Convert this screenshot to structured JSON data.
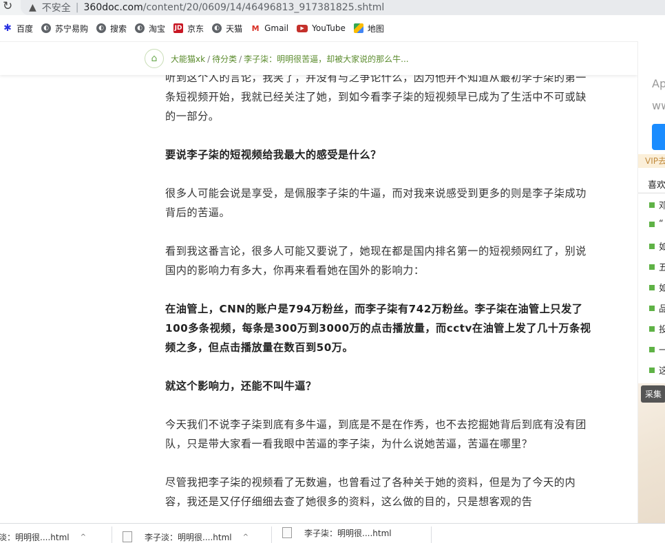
{
  "browser": {
    "reload_icon": "reload-icon",
    "security_label": "不安全",
    "url_host": "360doc.com",
    "url_path": "/content/20/0609/14/46496813_917381825.shtml"
  },
  "bookmarks": [
    {
      "label": "百度",
      "icon": "baidu-icon"
    },
    {
      "label": "苏宁易购",
      "icon": "globe-icon"
    },
    {
      "label": "搜索",
      "icon": "globe-icon"
    },
    {
      "label": "淘宝",
      "icon": "globe-icon"
    },
    {
      "label": "京东",
      "icon": "jd-icon"
    },
    {
      "label": "天猫",
      "icon": "globe-icon"
    },
    {
      "label": "Gmail",
      "icon": "gmail-icon"
    },
    {
      "label": "YouTube",
      "icon": "youtube-icon"
    },
    {
      "label": "地图",
      "icon": "maps-icon"
    }
  ],
  "breadcrumb": {
    "user": "大能猫xk",
    "category": "待分类",
    "title": "李子柒：明明很苦逼，却被大家说的那么牛..."
  },
  "article": {
    "p0": "听到这个人的言论，我笑了，并没有与之争论什么，因为他并不知道从最初李子柒的第一条短视频开始，我就已经关注了她，到如今看李子柒的短视频早已成为了生活中不可或缺的一部分。",
    "p1": "要说李子柒的短视频给我最大的感受是什么？",
    "p2": "很多人可能会说是享受，是佩服李子柒的牛逼，而对我来说感受到更多的则是李子柒成功背后的苦逼。",
    "p3": "看到我这番言论，很多人可能又要说了，她现在都是国内排名第一的短视频网红了，别说国内的影响力有多大，你再来看看她在国外的影响力：",
    "p4": "在油管上，CNN的账户是794万粉丝，而李子柒有742万粉丝。李子柒在油管上只发了100多条视频，每条是300万到3000万的点击播放量，而cctv在油管上发了几十万条视频之多，但点击播放量在数百到50万。",
    "p5": "就这个影响力，还能不叫牛逼？",
    "p6": "今天我们不说李子柒到底有多牛逼，到底是不是在作秀，也不去挖掘她背后到底有没有团队，只是带大家看一看我眼中苦逼的李子柒，为什么说她苦逼，苦逼在哪里？",
    "p7": "尽管我把李子柒的视频看了无数遍，也曾看过了各种关于她的资料，但是为了今天的内容，我还是又仔仔细细去查了她很多的资料，这么做的目的，只是想客观的告"
  },
  "sidebar": {
    "t1": "Ap",
    "t2": "ww",
    "vip": "VIP去",
    "like_title": "喜欢",
    "items": [
      "邓",
      "“",
      "如",
      "五",
      "如",
      "品",
      "投",
      "一",
      "这"
    ],
    "badge": "采集"
  },
  "downloads": [
    {
      "label": "淡：明明很....html"
    },
    {
      "label": "李子淡：明明很....html"
    },
    {
      "label": "李子柒：明明很....html"
    }
  ]
}
